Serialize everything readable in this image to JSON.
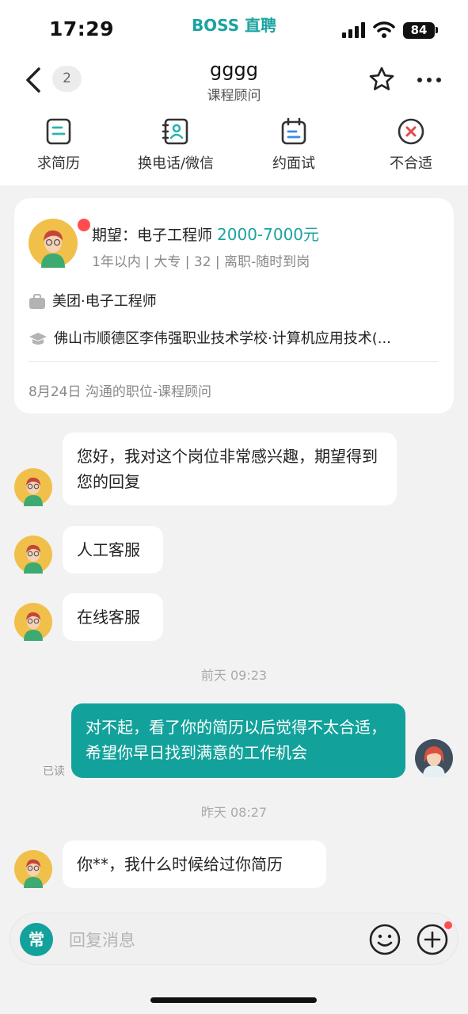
{
  "status_bar": {
    "time": "17:29",
    "app_name": "BOSS 直聘",
    "battery": "84"
  },
  "nav": {
    "unread_count": "2",
    "name": "gggg",
    "subtitle": "课程顾问"
  },
  "actions": [
    {
      "label": "求简历",
      "icon": "resume-icon"
    },
    {
      "label": "换电话/微信",
      "icon": "contact-icon"
    },
    {
      "label": "约面试",
      "icon": "calendar-icon"
    },
    {
      "label": "不合适",
      "icon": "reject-icon"
    }
  ],
  "card": {
    "expect_label": "期望：电子工程师",
    "salary": "2000-7000元",
    "meta": "1年以内 | 大专 | 32 | 离职-随时到岗",
    "work": "美团·电子工程师",
    "education": "佛山市顺德区李伟强职业技术学校·计算机应用技术(...",
    "footer": "8月24日 沟通的职位-课程顾问"
  },
  "messages": [
    {
      "text": "您好，我对这个岗位非常感兴趣，期望得到您的回复",
      "from": "them"
    },
    {
      "text": "人工客服",
      "from": "them"
    },
    {
      "text": "在线客服",
      "from": "them"
    },
    {
      "separator": "前天 09:23"
    },
    {
      "text": "对不起，看了你的简历以后觉得不太合适，希望你早日找到满意的工作机会",
      "from": "me",
      "status": "已读"
    },
    {
      "separator": "昨天 08:27"
    },
    {
      "text": "你**，我什么时候给过你简历",
      "from": "them"
    }
  ],
  "input": {
    "common_label": "常",
    "placeholder": "回复消息"
  },
  "colors": {
    "accent": "#13a29b",
    "background": "#f2f2f2",
    "badge_red": "#ff4d4f"
  }
}
